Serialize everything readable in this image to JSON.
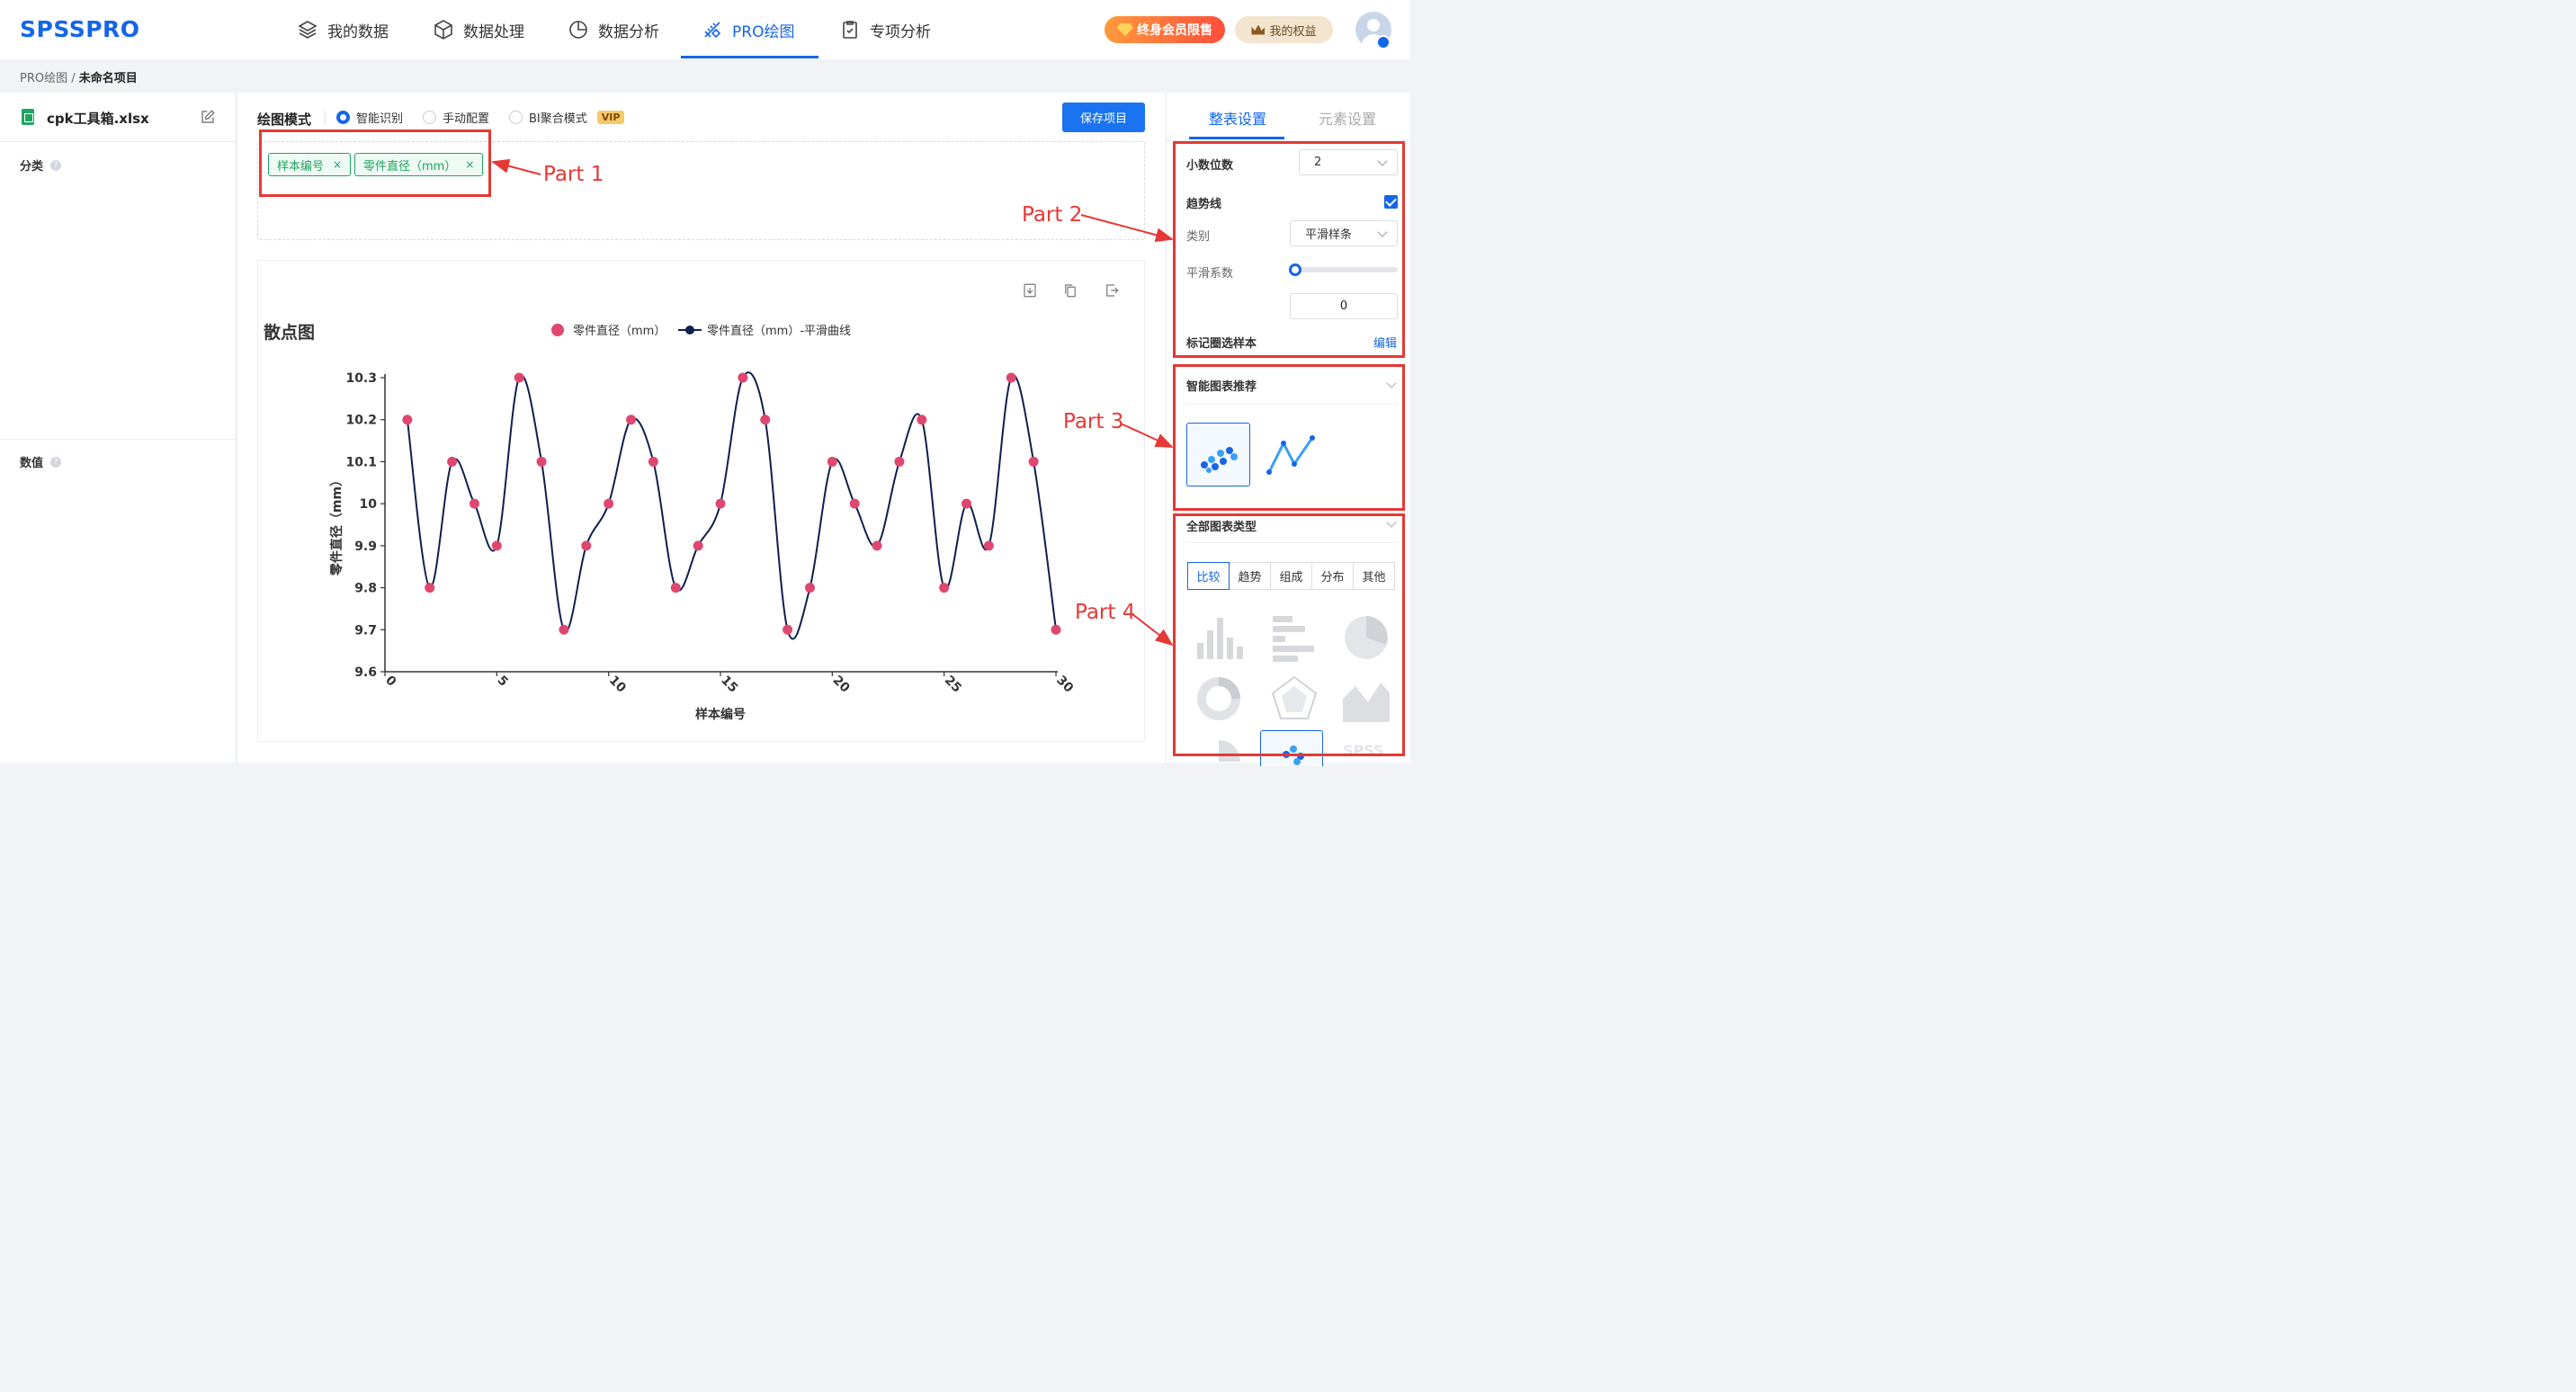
{
  "header": {
    "logo": "SPSSPRO",
    "nav": [
      {
        "label": "我的数据",
        "icon": "layers-icon"
      },
      {
        "label": "数据处理",
        "icon": "cube-icon"
      },
      {
        "label": "数据分析",
        "icon": "pie-icon"
      },
      {
        "label": "PRO绘图",
        "icon": "pen-ruler-icon"
      },
      {
        "label": "专项分析",
        "icon": "clipboard-check-icon"
      }
    ],
    "active_nav": "PRO绘图",
    "vip_button": "终身会员限售",
    "rights_button": "我的权益"
  },
  "breadcrumb": {
    "root": "PRO绘图",
    "separator": "/",
    "current": "未命名项目"
  },
  "left_panel": {
    "file_name": "cpk工具箱.xlsx",
    "sections": [
      {
        "label": "分类"
      },
      {
        "label": "数值"
      }
    ]
  },
  "toolbar": {
    "mode_label": "绘图模式",
    "modes": [
      {
        "label": "智能识别",
        "checked": true
      },
      {
        "label": "手动配置",
        "checked": false
      },
      {
        "label": "BI聚合模式",
        "checked": false,
        "badge": "VIP"
      }
    ],
    "save_label": "保存项目"
  },
  "fields": [
    {
      "label": "样本编号",
      "close": "×"
    },
    {
      "label": "零件直径（mm）",
      "close": "×"
    }
  ],
  "chart_card": {
    "title": "散点图",
    "tools": [
      "download-icon",
      "copy-icon",
      "export-icon"
    ]
  },
  "chart_data": {
    "type": "scatter",
    "title": "散点图",
    "xlabel": "样本编号",
    "ylabel": "零件直径（mm）",
    "xlim": [
      0,
      30
    ],
    "ylim": [
      9.6,
      10.3
    ],
    "xticks": [
      "0",
      "5",
      "10",
      "15",
      "20",
      "25",
      "30"
    ],
    "yticks": [
      "9.6",
      "9.7",
      "9.8",
      "9.9",
      "10",
      "10.1",
      "10.2",
      "10.3"
    ],
    "legend_position": "top",
    "series": [
      {
        "name": "零件直径（mm）",
        "kind": "scatter",
        "color": "#e0476f"
      },
      {
        "name": "零件直径（mm）-平滑曲线",
        "kind": "smooth-line",
        "color": "#0f1f4f"
      }
    ],
    "x": [
      1,
      2,
      3,
      4,
      5,
      6,
      7,
      8,
      9,
      10,
      11,
      12,
      13,
      14,
      15,
      16,
      17,
      18,
      19,
      20,
      21,
      22,
      23,
      24,
      25,
      26,
      27,
      28,
      29,
      30
    ],
    "values": [
      10.2,
      9.8,
      10.1,
      10.0,
      9.9,
      10.3,
      10.1,
      9.7,
      9.9,
      10.0,
      10.2,
      10.1,
      9.8,
      9.9,
      10.0,
      10.3,
      10.2,
      9.7,
      9.8,
      10.1,
      10.0,
      9.9,
      10.1,
      10.2,
      9.8,
      10.0,
      9.9,
      10.3,
      10.1,
      9.7
    ],
    "grid": false
  },
  "right_panel": {
    "tabs": [
      "整表设置",
      "元素设置"
    ],
    "active_tab": "整表设置",
    "decimal_label": "小数位数",
    "decimal_value": "2",
    "trend_label": "趋势线",
    "trend_checked": true,
    "type_label": "类别",
    "type_value": "平滑样条",
    "smooth_label": "平滑系数",
    "smooth_value": "0",
    "smooth_level": 0,
    "mark_label": "标记圈选样本",
    "mark_edit": "编辑",
    "recommend_title": "智能图表推荐",
    "recommend": [
      "scatter-chart-icon",
      "line-chart-icon"
    ],
    "all_types_title": "全部图表类型",
    "type_tabs": [
      "比较",
      "趋势",
      "组成",
      "分布",
      "其他"
    ],
    "active_type_tab": "比较",
    "chart_thumbs": [
      "bar-chart-icon",
      "horizontal-bar-icon",
      "pie-chart-icon",
      "donut-chart-icon",
      "radar-chart-icon",
      "area-chart-icon"
    ],
    "watermark": "SPSS"
  },
  "annotations": [
    "Part 1",
    "Part 2",
    "Part 3",
    "Part 4"
  ],
  "colors": {
    "brand": "#1565e8",
    "tag_green": "#1fa463",
    "annotation_red": "#e53935",
    "point": "#e0476f",
    "curve": "#0f1f4f"
  }
}
